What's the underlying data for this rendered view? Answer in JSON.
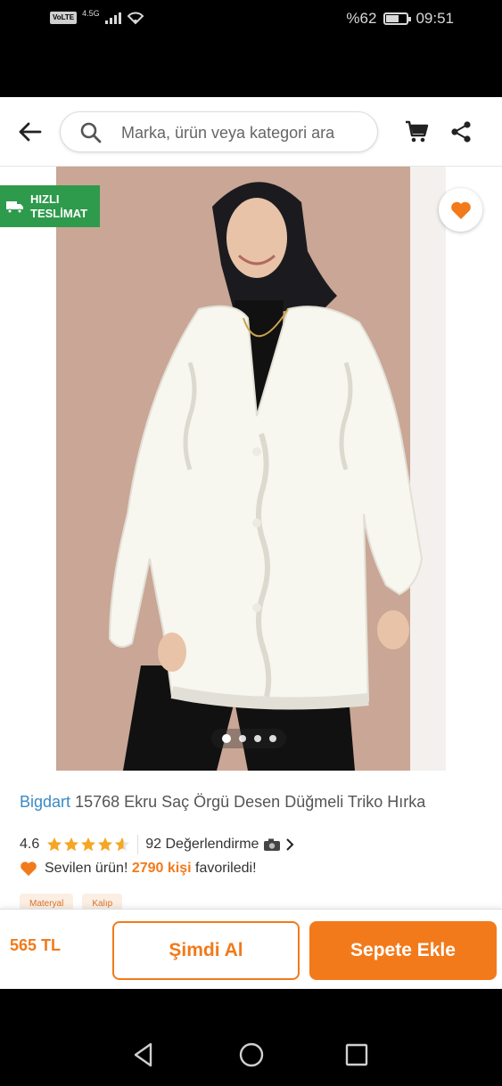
{
  "status_bar": {
    "network_badge": "VoLTE",
    "signal_type": "4.5G",
    "battery_text": "%62",
    "battery_level": 0.62,
    "time": "09:51"
  },
  "top_bar": {
    "search_placeholder": "Marka, ürün veya kategori ara",
    "icons": [
      "back-arrow-icon",
      "search-icon",
      "cart-icon",
      "share-icon"
    ]
  },
  "gallery": {
    "badge_line1": "HIZLI",
    "badge_line2": "TESLİMAT",
    "image_count": 4,
    "active_index": 0
  },
  "product": {
    "brand": "Bigdart",
    "name": "15768 Ekru Saç Örgü Desen Düğmeli Triko Hırka",
    "rating": "4.6",
    "rating_value": 4.6,
    "reviews": "92 Değerlendirme",
    "favorite_prefix": "Sevilen ürün!",
    "favorite_count": "2790 kişi",
    "favorite_suffix": "favoriledi!",
    "chips": [
      "Materyal",
      "Kalıp"
    ]
  },
  "bottom_bar": {
    "price": "565 TL",
    "buy_now": "Şimdi Al",
    "add_to_cart": "Sepete Ekle"
  },
  "colors": {
    "accent": "#f27a1a",
    "brand_link": "#3b8ac4",
    "fast_delivery": "#2e9a4b"
  }
}
